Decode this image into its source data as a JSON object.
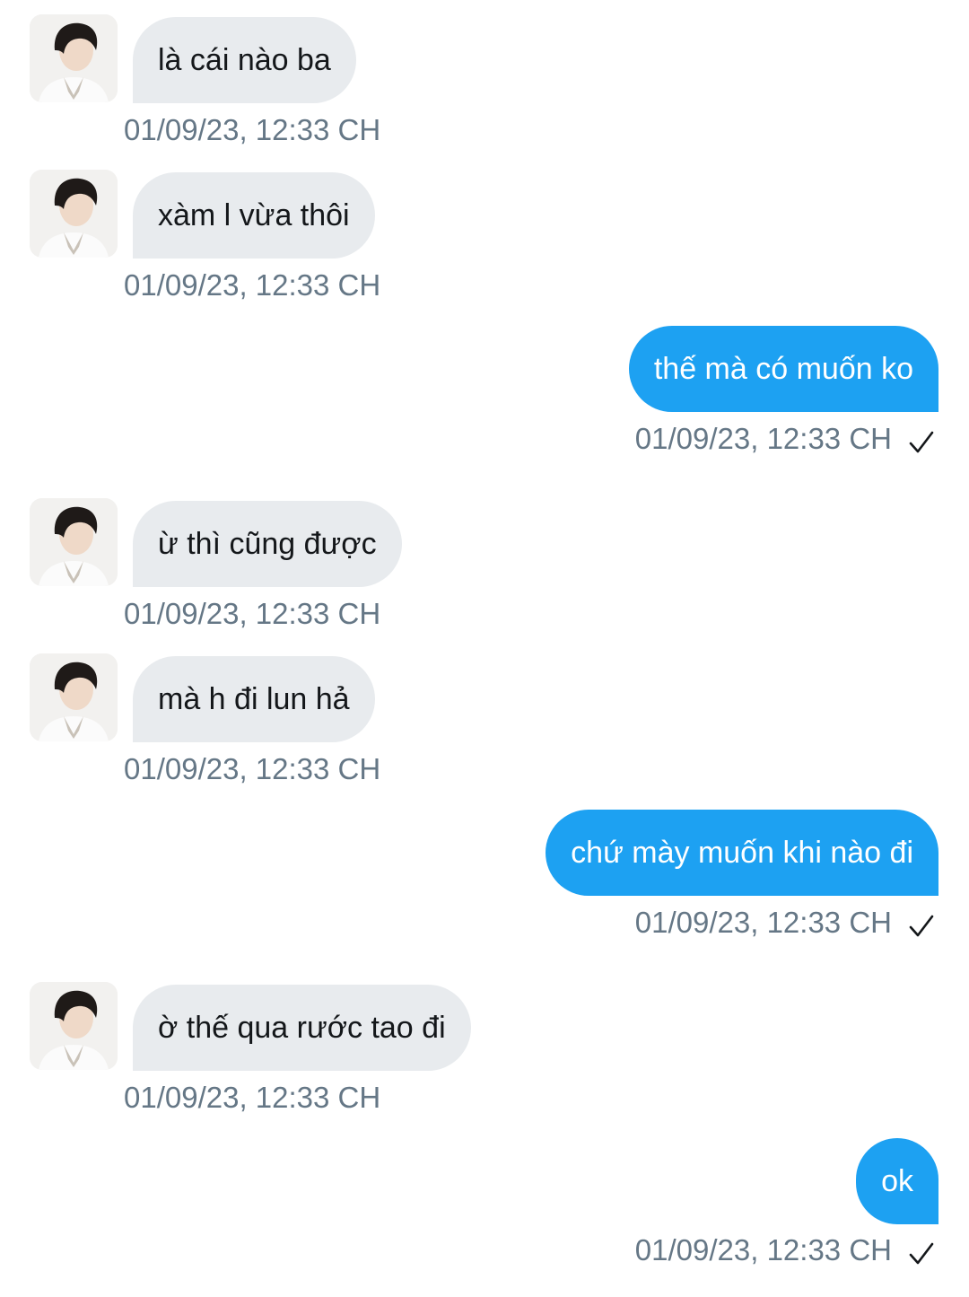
{
  "conversation": {
    "messages": [
      {
        "direction": "received",
        "text": "là cái nào ba",
        "time": "01/09/23, 12:33 CH"
      },
      {
        "direction": "received",
        "text": "xàm l vừa thôi",
        "time": "01/09/23, 12:33 CH"
      },
      {
        "direction": "sent",
        "text": "thế mà có muốn ko",
        "time": "01/09/23, 12:33 CH",
        "status_icon": "checkmark-icon"
      },
      {
        "direction": "received",
        "text": "ừ thì cũng được",
        "time": "01/09/23, 12:33 CH"
      },
      {
        "direction": "received",
        "text": "mà h đi lun hả",
        "time": "01/09/23, 12:33 CH"
      },
      {
        "direction": "sent",
        "text": "chứ mày muốn khi nào đi",
        "time": "01/09/23, 12:33 CH",
        "status_icon": "checkmark-icon"
      },
      {
        "direction": "received",
        "text": "ờ thế qua rước tao đi",
        "time": "01/09/23, 12:33 CH"
      },
      {
        "direction": "sent",
        "text": "ok",
        "time": "01/09/23, 12:33 CH",
        "status_icon": "checkmark-icon"
      }
    ]
  },
  "colors": {
    "sent_bubble": "#1da1f2",
    "received_bubble": "#e8ebee",
    "timestamp": "#657786"
  }
}
